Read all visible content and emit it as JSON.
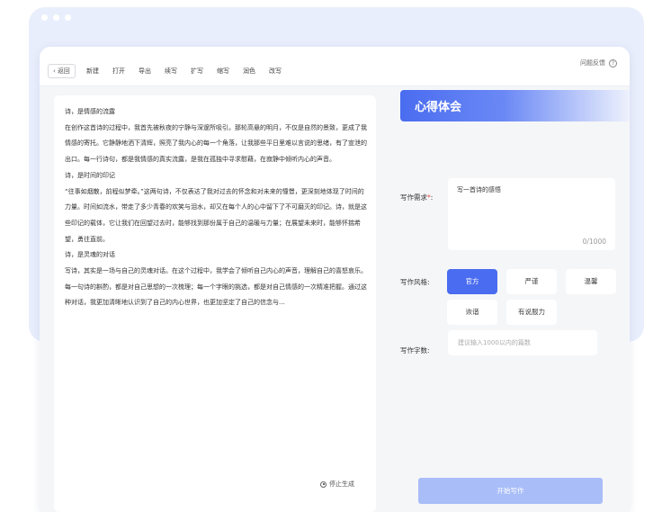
{
  "toolbar": {
    "back_label": "返回",
    "menu": [
      "新建",
      "打开",
      "导出",
      "续写",
      "扩写",
      "缩写",
      "润色",
      "改写"
    ],
    "feedback_label": "问题反馈"
  },
  "document": {
    "paragraphs": [
      "诗，是情感的流露",
      "在创作这首诗的过程中，我首先被秋夜的宁静与深邃所吸引。那轮高悬的明月，不仅是自然的景致，更成了我情感的寄托。它静静地洒下清辉，照亮了我内心的每一个角落，让我那些平日里难以言说的思绪，有了宣泄的出口。每一行诗句，都是我情感的真实流露，是我在孤独中寻求慰藉，在寂静中倾听内心的声音。",
      "诗，是时间的印记",
      "“往事如烟散，前程似梦牵。”这两句诗，不仅表达了我对过去的怀念和对未来的憧憬，更深刻地体现了时间的力量。时间如流水，带走了多少青春的欢笑与泪水，却又在每个人的心中留下了不可磨灭的印记。诗，就是这些印记的载体，它让我们在回望过去时，能够找到那份属于自己的温暖与力量；在展望未来时，能够怀揣希望，勇往直前。",
      "诗，是灵魂的对话",
      "写诗，其实是一场与自己的灵魂对话。在这个过程中，我学会了倾听自己内心的声音，理解自己的喜怒哀乐。每一句诗的斟酌，都是对自己思想的一次梳理；每一个字眼的挑选，都是对自己情感的一次精准把握。通过这种对话，我更加清晰地认识到了自己的内心世界，也更加坚定了自己的信念与..."
    ],
    "stop_label": "停止生成"
  },
  "panel": {
    "title": "心得体会",
    "requirement_label": "写作需求",
    "requirement_value": "写一首诗的感悟",
    "counter": "0/1000",
    "style_label": "写作风格:",
    "styles": [
      "官方",
      "严谨",
      "温馨",
      "诙谐",
      "有说服力"
    ],
    "selected_style": "官方",
    "wordcount_label": "写作字数:",
    "wordcount_placeholder": "建议输入1000以内的篇数",
    "start_label": "开始写作"
  },
  "colors": {
    "accent": "#4a6cf0",
    "start_button": "#a9bdf8",
    "required": "#e24b4b"
  }
}
